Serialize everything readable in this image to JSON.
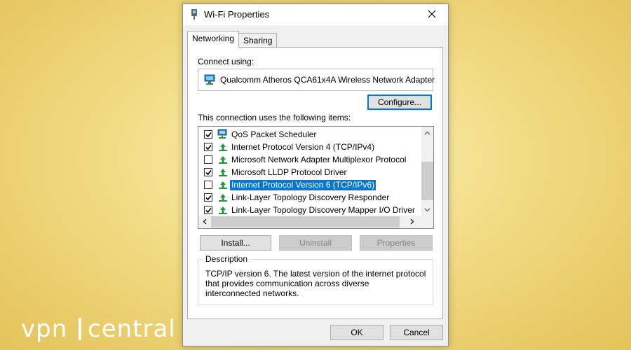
{
  "window": {
    "title": "Wi-Fi Properties",
    "icon": "wifi-adapter-icon",
    "close_icon": "close-icon"
  },
  "tabs": [
    {
      "label": "Networking",
      "active": true
    },
    {
      "label": "Sharing",
      "active": false
    }
  ],
  "networking": {
    "connect_using_label": "Connect using:",
    "adapter_name": "Qualcomm Atheros QCA61x4A Wireless Network Adapter",
    "configure_label": "Configure...",
    "items_label": "This connection uses the following items:",
    "items": [
      {
        "label": "QoS Packet Scheduler",
        "checked": true,
        "icon": "network-scheduler-icon",
        "selected": false
      },
      {
        "label": "Internet Protocol Version 4 (TCP/IPv4)",
        "checked": true,
        "icon": "protocol-icon",
        "selected": false
      },
      {
        "label": "Microsoft Network Adapter Multiplexor Protocol",
        "checked": false,
        "icon": "protocol-icon",
        "selected": false
      },
      {
        "label": "Microsoft LLDP Protocol Driver",
        "checked": true,
        "icon": "protocol-icon",
        "selected": false
      },
      {
        "label": "Internet Protocol Version 6 (TCP/IPv6)",
        "checked": false,
        "icon": "protocol-icon",
        "selected": true
      },
      {
        "label": "Link-Layer Topology Discovery Responder",
        "checked": true,
        "icon": "protocol-icon",
        "selected": false
      },
      {
        "label": "Link-Layer Topology Discovery Mapper I/O Driver",
        "checked": true,
        "icon": "protocol-icon",
        "selected": false
      }
    ],
    "install_label": "Install...",
    "uninstall_label": "Uninstall",
    "properties_label": "Properties",
    "description_legend": "Description",
    "description_text": "TCP/IP version 6. The latest version of the internet protocol that provides communication across diverse interconnected networks."
  },
  "footer": {
    "ok_label": "OK",
    "cancel_label": "Cancel"
  },
  "watermark": {
    "part1": "vpn",
    "part2": "central"
  },
  "colors": {
    "selection": "#0078d7",
    "protocol_icon": "#1d9a3a",
    "background": "#f2dc86"
  }
}
